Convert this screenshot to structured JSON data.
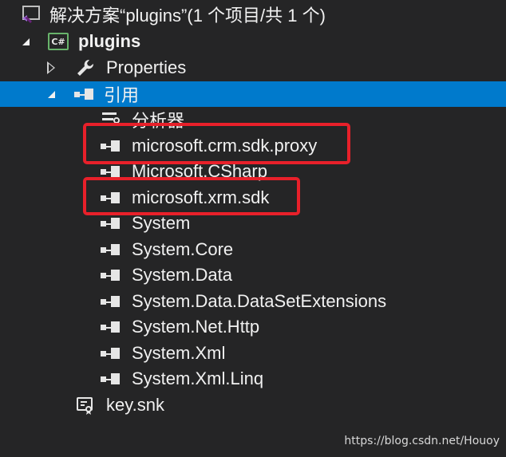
{
  "solution": {
    "label": "解决方案“plugins”(1 个项目/共 1 个)",
    "icon": "visual-studio-solution-icon"
  },
  "project": {
    "label": "plugins",
    "icon": "csharp-project-icon",
    "icon_text": "C#"
  },
  "properties": {
    "label": "Properties",
    "icon": "wrench-icon"
  },
  "references": {
    "label": "引用",
    "icon": "reference-icon",
    "selected": true,
    "items": [
      {
        "label": "分析器",
        "icon": "analyzer-icon"
      },
      {
        "label": "microsoft.crm.sdk.proxy",
        "icon": "reference-icon",
        "highlighted": true
      },
      {
        "label": "Microsoft.CSharp",
        "icon": "reference-icon"
      },
      {
        "label": "microsoft.xrm.sdk",
        "icon": "reference-icon",
        "highlighted": true
      },
      {
        "label": "System",
        "icon": "reference-icon"
      },
      {
        "label": "System.Core",
        "icon": "reference-icon"
      },
      {
        "label": "System.Data",
        "icon": "reference-icon"
      },
      {
        "label": "System.Data.DataSetExtensions",
        "icon": "reference-icon"
      },
      {
        "label": "System.Net.Http",
        "icon": "reference-icon"
      },
      {
        "label": "System.Xml",
        "icon": "reference-icon"
      },
      {
        "label": "System.Xml.Linq",
        "icon": "reference-icon"
      }
    ]
  },
  "key_file": {
    "label": "key.snk",
    "icon": "key-certificate-icon"
  },
  "watermark": "https://blog.csdn.net/Houoy",
  "colors": {
    "background": "#252526",
    "selection": "#007acc",
    "highlight_border": "#e8202a",
    "text": "#f1f1f1"
  }
}
